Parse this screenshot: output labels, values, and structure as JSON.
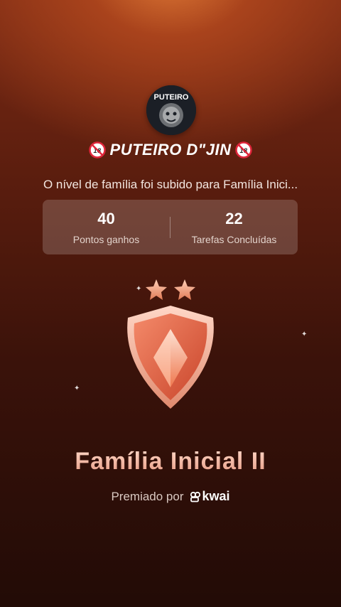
{
  "group": {
    "avatar_text": "PUTEIRO",
    "name": "PUTEIRO D\"JIN"
  },
  "message": "O nível de família foi subido para Família Inici...",
  "stats": [
    {
      "value": "40",
      "label": "Pontos ganhos"
    },
    {
      "value": "22",
      "label": "Tarefas Concluídas"
    }
  ],
  "badge": {
    "stars": 2,
    "icon": "shield-badge-icon"
  },
  "level": {
    "name": "Família Inicial II"
  },
  "awarded": {
    "prefix": "Premiado por",
    "brand": "kwai"
  },
  "colors": {
    "background_top": "#a9431c",
    "background_bottom": "#220b06",
    "level_text": "#f2b8a4",
    "star": "#e8896a"
  }
}
